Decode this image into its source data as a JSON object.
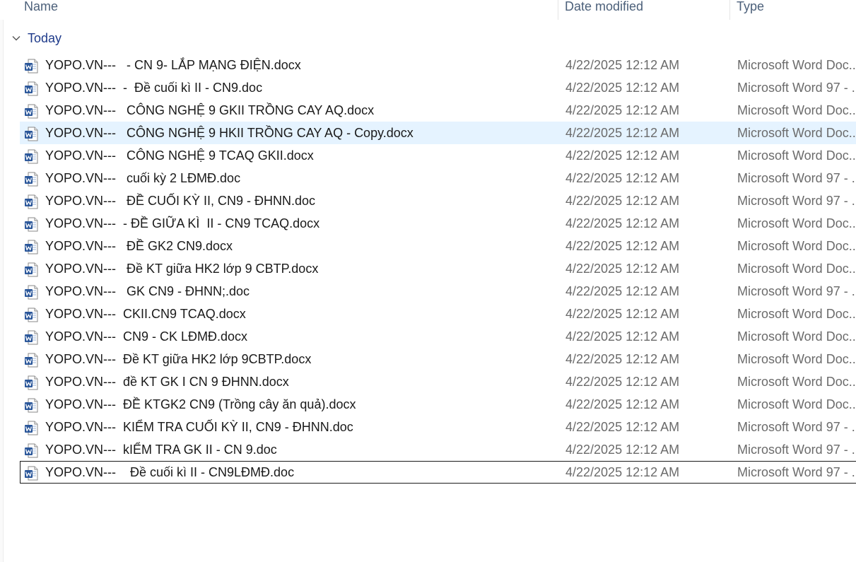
{
  "columns": {
    "name": "Name",
    "date": "Date modified",
    "type": "Type"
  },
  "group": {
    "label": "Today",
    "chevron_icon": "chevron-down-icon"
  },
  "file_icon": "word-document-icon",
  "colors": {
    "accent_hover": "#e5f3ff",
    "word_blue": "#2b579a",
    "group_text": "#1e3a8a"
  },
  "files": [
    {
      "name": "YOPO.VN---   - CN 9- LẮP MẠNG ĐIỆN.docx",
      "date": "4/22/2025 12:12 AM",
      "type": "Microsoft Word Doc..."
    },
    {
      "name": "YOPO.VN---  -  Đề cuối kì II - CN9.doc",
      "date": "4/22/2025 12:12 AM",
      "type": "Microsoft Word 97 - ..."
    },
    {
      "name": "YOPO.VN---   CÔNG NGHỆ 9 GKII TRỒNG CAY AQ.docx",
      "date": "4/22/2025 12:12 AM",
      "type": "Microsoft Word Doc..."
    },
    {
      "name": "YOPO.VN---   CÔNG NGHỆ 9 HKII TRỒNG CAY AQ - Copy.docx",
      "date": "4/22/2025 12:12 AM",
      "type": "Microsoft Word Doc..."
    },
    {
      "name": "YOPO.VN---   CÔNG NGHỆ 9 TCAQ GKII.docx",
      "date": "4/22/2025 12:12 AM",
      "type": "Microsoft Word Doc..."
    },
    {
      "name": "YOPO.VN---   cuối kỳ 2 LĐMĐ.doc",
      "date": "4/22/2025 12:12 AM",
      "type": "Microsoft Word 97 - ..."
    },
    {
      "name": "YOPO.VN---   ĐỀ CUỐI KỲ II, CN9 - ĐHNN.doc",
      "date": "4/22/2025 12:12 AM",
      "type": "Microsoft Word 97 - ..."
    },
    {
      "name": "YOPO.VN---  - ĐỀ GIỮA KÌ  II - CN9 TCAQ.docx",
      "date": "4/22/2025 12:12 AM",
      "type": "Microsoft Word Doc..."
    },
    {
      "name": "YOPO.VN---   ĐỀ GK2 CN9.docx",
      "date": "4/22/2025 12:12 AM",
      "type": "Microsoft Word Doc..."
    },
    {
      "name": "YOPO.VN---   Đề KT giữa HK2 lớp 9 CBTP.docx",
      "date": "4/22/2025 12:12 AM",
      "type": "Microsoft Word Doc..."
    },
    {
      "name": "YOPO.VN---   GK CN9 - ĐHNN;.doc",
      "date": "4/22/2025 12:12 AM",
      "type": "Microsoft Word 97 - ..."
    },
    {
      "name": "YOPO.VN---  CKII.CN9 TCAQ.docx",
      "date": "4/22/2025 12:12 AM",
      "type": "Microsoft Word Doc..."
    },
    {
      "name": "YOPO.VN---  CN9 - CK LĐMĐ.docx",
      "date": "4/22/2025 12:12 AM",
      "type": "Microsoft Word Doc..."
    },
    {
      "name": "YOPO.VN---  Đề KT giữa HK2 lớp 9CBTP.docx",
      "date": "4/22/2025 12:12 AM",
      "type": "Microsoft Word Doc..."
    },
    {
      "name": "YOPO.VN---  đề KT GK I CN 9 ĐHNN.docx",
      "date": "4/22/2025 12:12 AM",
      "type": "Microsoft Word Doc..."
    },
    {
      "name": "YOPO.VN---  ĐỀ KTGK2 CN9 (Trồng cây ăn quả).docx",
      "date": "4/22/2025 12:12 AM",
      "type": "Microsoft Word Doc..."
    },
    {
      "name": "YOPO.VN---  KIỂM TRA CUỐI KỲ II, CN9 - ĐHNN.doc",
      "date": "4/22/2025 12:12 AM",
      "type": "Microsoft Word 97 - ..."
    },
    {
      "name": "YOPO.VN---  kIỂM TRA GK II - CN 9.doc",
      "date": "4/22/2025 12:12 AM",
      "type": "Microsoft Word 97 - ..."
    },
    {
      "name": "YOPO.VN---    Đề cuối kì II - CN9LĐMĐ.doc",
      "date": "4/22/2025 12:12 AM",
      "type": "Microsoft Word 97 - ..."
    }
  ]
}
